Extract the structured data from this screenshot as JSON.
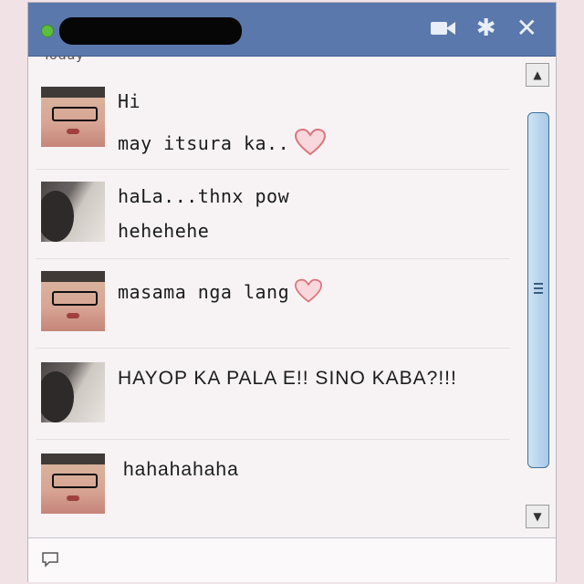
{
  "window": {
    "title_redacted": true
  },
  "conversation": {
    "day_label": "Today",
    "groups": [
      {
        "sender": "friend",
        "lines": [
          "Hi",
          "may itsura ka.."
        ],
        "heart_after_line": 1
      },
      {
        "sender": "self",
        "lines": [
          "haLa...thnx pow",
          "hehehehe"
        ]
      },
      {
        "sender": "friend",
        "lines": [
          "masama nga lang"
        ],
        "heart_after_line": 0
      },
      {
        "sender": "self",
        "lines": [
          "HAYOP KA PALA E!! SINO KABA?!!!"
        ]
      },
      {
        "sender": "friend",
        "lines": [
          "hahahahaha"
        ]
      }
    ]
  },
  "icons": {
    "video": "video-camera-icon",
    "settings": "gear-icon",
    "close": "close-icon",
    "heart": "heart-icon",
    "emoticon": "emoticon-icon"
  },
  "colors": {
    "titlebar": "#5a78ac",
    "status_online": "#5dbd3c",
    "heart": "#d9767c"
  }
}
